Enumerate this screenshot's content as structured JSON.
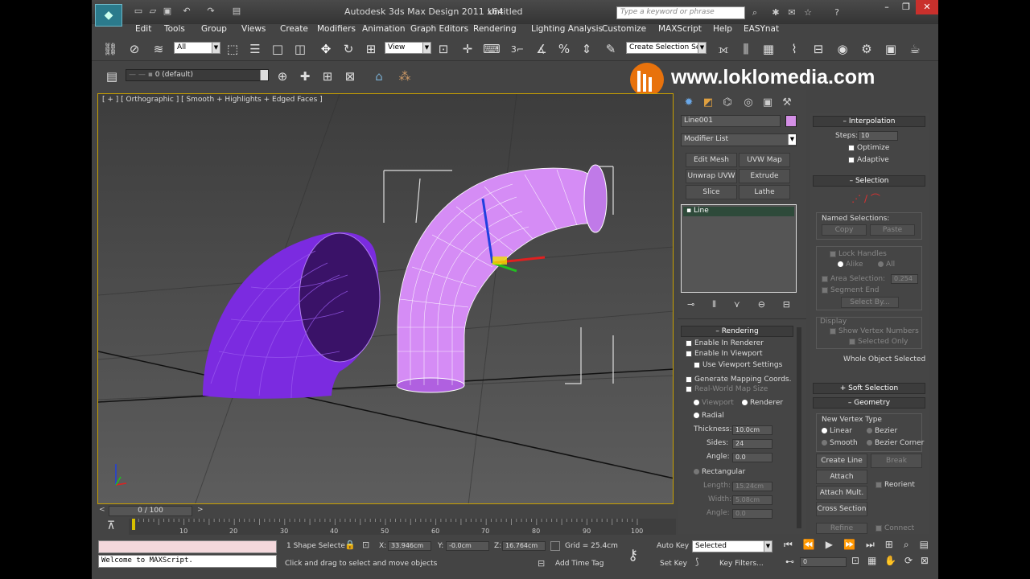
{
  "app": {
    "title": "Autodesk 3ds Max Design 2011 x64",
    "document": "Untitled",
    "logo": "3ds-max-logo"
  },
  "search": {
    "placeholder": "Type a keyword or phrase"
  },
  "window": {
    "minimize": "–",
    "maximize": "❐",
    "close": "✕"
  },
  "menu": [
    "Edit",
    "Tools",
    "Group",
    "Views",
    "Create",
    "Modifiers",
    "Animation",
    "Graph Editors",
    "Rendering",
    "Lighting Analysis",
    "Customize",
    "MAXScript",
    "Help",
    "EASYnat"
  ],
  "toolbar": {
    "selection_filter": "All",
    "ref_coord": "View",
    "named_selection": "Create Selection Se",
    "layer": "0 (default)",
    "snap_label": "3"
  },
  "watermark": {
    "text": "www.loklomedia.com",
    "color": "#e8720c"
  },
  "viewport": {
    "label": "[ + ] [ Orthographic ] [ Smooth + Highlights + Edged Faces ]",
    "border_color": "#c9a000",
    "object_color": "#7b2be0",
    "selected_color": "#d080ff"
  },
  "command_panel": {
    "object_name": "Line001",
    "object_color": "#d48fe6",
    "modifier_list": "Modifier List",
    "modifier_buttons": [
      "Edit Mesh",
      "UVW Map",
      "Unwrap UVW",
      "Extrude",
      "Slice",
      "Lathe"
    ],
    "stack_item": "Line",
    "rendering": {
      "header": "Rendering",
      "enable_renderer": "Enable In Renderer",
      "enable_viewport": "Enable In Viewport",
      "use_viewport_settings": "Use Viewport Settings",
      "gen_mapping": "Generate Mapping Coords.",
      "real_world": "Real-World Map Size",
      "viewport_opt": "Viewport",
      "renderer_opt": "Renderer",
      "radial": "Radial",
      "thickness_label": "Thickness:",
      "thickness": "10.0cm",
      "sides_label": "Sides:",
      "sides": "24",
      "angle_label": "Angle:",
      "angle": "0.0",
      "rectangular": "Rectangular",
      "length_label": "Length:",
      "length": "15.24cm",
      "width_label": "Width:",
      "width": "5.08cm",
      "angle2_label": "Angle:",
      "angle2": "0.0"
    }
  },
  "right_panel": {
    "interpolation": {
      "header": "Interpolation",
      "steps_label": "Steps:",
      "steps": "10",
      "optimize": "Optimize",
      "adaptive": "Adaptive"
    },
    "selection": {
      "header": "Selection",
      "named_selections": "Named Selections:",
      "copy": "Copy",
      "paste": "Paste",
      "lock_handles": "Lock Handles",
      "alike": "Alike",
      "all": "All",
      "area_selection": "Area Selection:",
      "area_value": "0.254",
      "segment_end": "Segment End",
      "select_by": "Select By...",
      "display": "Display",
      "show_vertex_numbers": "Show Vertex Numbers",
      "selected_only": "Selected Only",
      "whole_object_selected": "Whole Object Selected"
    },
    "soft_selection": {
      "header": "Soft Selection"
    },
    "geometry": {
      "header": "Geometry",
      "new_vertex_type": "New Vertex Type",
      "linear": "Linear",
      "bezier": "Bezier",
      "smooth": "Smooth",
      "bezier_corner": "Bezier Corner",
      "create_line": "Create Line",
      "break": "Break",
      "attach": "Attach",
      "reorient": "Reorient",
      "attach_mult": "Attach Mult.",
      "cross_section": "Cross Section",
      "refine": "Refine",
      "connect": "Connect"
    }
  },
  "timeline": {
    "frame": "0 / 100",
    "ticks": [
      "10",
      "20",
      "30",
      "40",
      "50",
      "60",
      "70",
      "80",
      "90",
      "100"
    ]
  },
  "status": {
    "maxscript": "Welcome to MAXScript.",
    "selected": "1 Shape Selecte",
    "x_label": "X:",
    "x": "33.946cm",
    "y_label": "Y:",
    "y": "-0.0cm",
    "z_label": "Z:",
    "z": "16.764cm",
    "grid": "Grid = 25.4cm",
    "prompt": "Click and drag to select and move objects",
    "add_time_tag": "Add Time Tag",
    "auto_key": "Auto Key",
    "set_key": "Set Key",
    "key_mode": "Selected",
    "key_filters": "Key Filters...",
    "current_frame": "0"
  }
}
